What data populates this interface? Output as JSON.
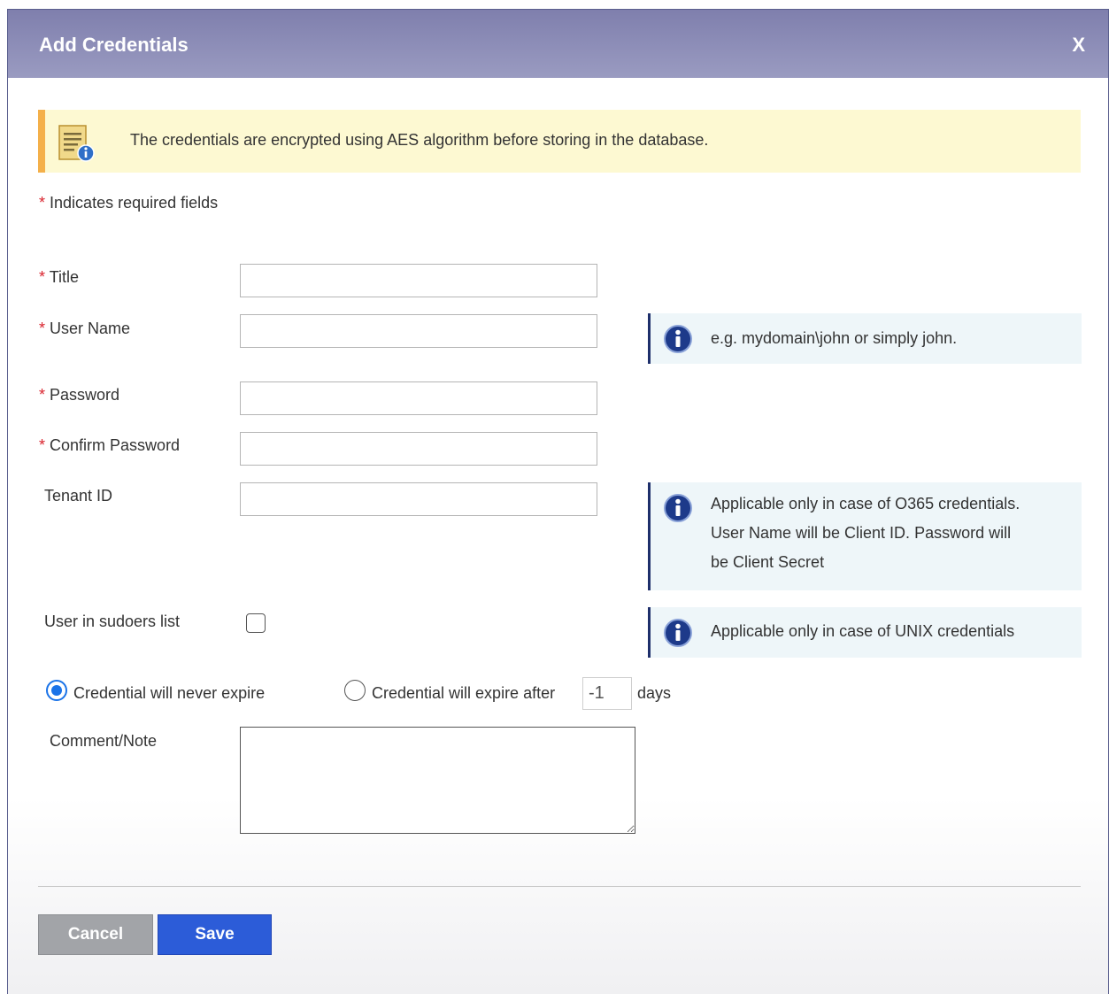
{
  "dialog": {
    "title": "Add Credentials",
    "close_label": "X"
  },
  "notice": {
    "text": "The credentials are encrypted using AES algorithm before storing in the database.",
    "icon": "document-info-icon"
  },
  "required_note": {
    "star": "*",
    "text": "Indicates required fields"
  },
  "fields": {
    "title": {
      "label": "Title",
      "required": true,
      "value": ""
    },
    "user_name": {
      "label": "User Name",
      "required": true,
      "value": ""
    },
    "password": {
      "label": "Password",
      "required": true,
      "value": ""
    },
    "confirm_password": {
      "label": "Confirm Password",
      "required": true,
      "value": ""
    },
    "tenant_id": {
      "label": "Tenant ID",
      "required": false,
      "value": ""
    },
    "sudoers": {
      "label": "User in sudoers list",
      "checked": false
    },
    "comment": {
      "label": "Comment/Note",
      "value": ""
    }
  },
  "hints": {
    "user_name": [
      "e.g. mydomain\\john or simply john."
    ],
    "tenant_id": [
      "Applicable only in case of O365 credentials.",
      "User Name will be Client ID. Password will",
      "be Client Secret"
    ],
    "sudoers": [
      "Applicable only in case of UNIX credentials"
    ]
  },
  "expiry": {
    "never_label": "Credential will never expire",
    "after_label": "Credential will expire after",
    "days_value": "-1",
    "days_unit": "days",
    "selected": "never"
  },
  "buttons": {
    "cancel": "Cancel",
    "save": "Save"
  },
  "colors": {
    "title_bar": "#8c8db8",
    "required_star": "#d9232d",
    "notice_bg": "#fdf9d2",
    "notice_accent": "#f4b04a",
    "hint_bg": "#eef6f9",
    "hint_border": "#1e2f6b",
    "save_button": "#2c5cd8",
    "cancel_button": "#a2a4a8"
  }
}
